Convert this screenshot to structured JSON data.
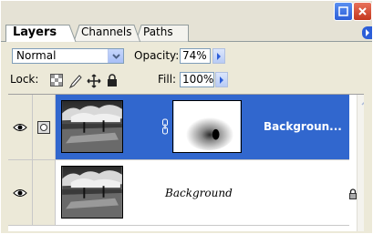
{
  "tabs": [
    {
      "label": "Layers",
      "active": true
    },
    {
      "label": "Channels",
      "active": false
    },
    {
      "label": "Paths",
      "active": false
    }
  ],
  "blend_mode": {
    "value": "Normal"
  },
  "opacity": {
    "label": "Opacity:",
    "value": "74%"
  },
  "lock": {
    "label": "Lock:"
  },
  "fill": {
    "label": "Fill:",
    "value": "100%"
  },
  "layers": [
    {
      "name": "Backgroun...",
      "selected": true,
      "has_mask": true
    },
    {
      "name": "Background",
      "selected": false,
      "locked": true
    }
  ],
  "colors": {
    "selection": "#3167ce",
    "panel_bg": "#ece9d8"
  }
}
